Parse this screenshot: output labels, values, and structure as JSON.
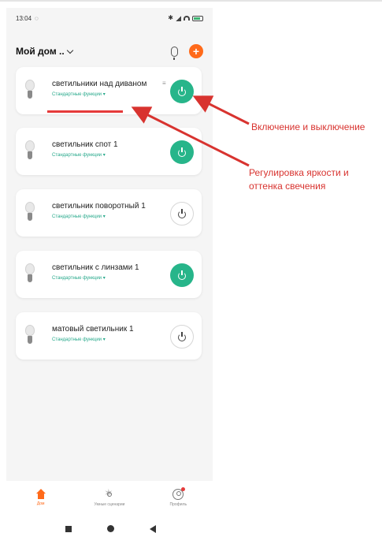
{
  "status_bar": {
    "time": "13:04"
  },
  "header": {
    "home_name": "Мой дом .."
  },
  "devices": [
    {
      "name": "светильники над диваном",
      "link": "Стандартные функции",
      "power": "on"
    },
    {
      "name": "светильник спот 1",
      "link": "Стандартные функции",
      "power": "on"
    },
    {
      "name": "светильник поворотный 1",
      "link": "Стандартные функции",
      "power": "off"
    },
    {
      "name": "светильник с линзами 1",
      "link": "Стандартные функции",
      "power": "on"
    },
    {
      "name": "матовый светильник 1",
      "link": "Стандартные функции",
      "power": "off"
    }
  ],
  "tabs": [
    {
      "label": "Дом",
      "active": true,
      "icon": "home-icon"
    },
    {
      "label": "Умные сценарии",
      "active": false,
      "icon": "sun-icon"
    },
    {
      "label": "Профиль",
      "active": false,
      "icon": "profile-icon"
    }
  ],
  "annotations": {
    "power": "Включение и выключение",
    "brightness": "Регулировка яркости и оттенка свечения"
  },
  "colors": {
    "accent": "#ff6a1a",
    "power_on": "#27b58a",
    "link": "#25a88a",
    "annotation": "#d8332f"
  }
}
